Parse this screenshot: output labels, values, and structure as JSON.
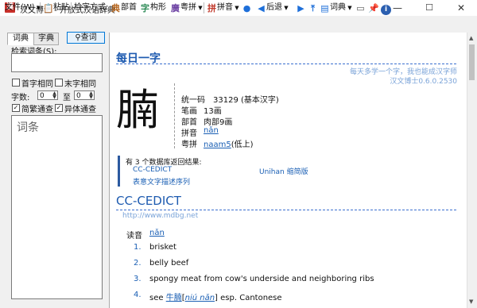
{
  "window": {
    "title": "汉文博士 - 开放式汉语辞典",
    "icon_glyph": "漢",
    "controls": {
      "minimize": "—",
      "maximize": "☐",
      "close": "✕"
    }
  },
  "toolbar": {
    "file_menu": "文件(W)",
    "paste": "粘贴",
    "search_mode_label": "检字方式:",
    "radical": "部首",
    "component": "构形",
    "cantonese": "粤拼",
    "pinyin": "拼音",
    "back": "后退",
    "dictionary": "词典"
  },
  "left_panel": {
    "tab_words": "词典",
    "tab_chars": "字典",
    "query_button": "查词",
    "search_label": "检索词条(S):",
    "search_value": "",
    "opt_first_same": "首字相同",
    "opt_last_same": "末字相同",
    "char_count_label": "字数:",
    "count_from": "0",
    "count_to_label": "至",
    "count_to": "0",
    "opt_simp_trad": "简繁通查",
    "opt_variants": "异体通查",
    "opt_simp_trad_checked": true,
    "opt_variants_checked": true,
    "list_header": "词条"
  },
  "content": {
    "daily_title": "每日一字",
    "tagline": "每天多学一个字，我也能成汉字师",
    "version": "汉文博士0.6.0.2530",
    "character": "腩",
    "info": [
      {
        "key": "统一码",
        "value": "33129 (基本汉字)"
      },
      {
        "key": "笔画",
        "value": "13画"
      },
      {
        "key": "部首",
        "value": "肉部9画"
      },
      {
        "key": "拼音",
        "value": "nǎn"
      },
      {
        "key": "粤拼",
        "value": "naam5",
        "suffix": "(低上)"
      }
    ],
    "db_header": "有 3 个数据库返回结果:",
    "db_links": [
      "CC-CEDICT",
      "Unihan 缩简版",
      "表意文字描述序列"
    ],
    "cedict_title": "CC-CEDICT",
    "cedict_url": "http://www.mdbg.net",
    "reading_label": "读音",
    "reading_value": "nǎn",
    "definitions": [
      {
        "num": "1.",
        "text": "brisket"
      },
      {
        "num": "2.",
        "text": "belly beef"
      },
      {
        "num": "3.",
        "text": "spongy meat from cow's underside and neighboring ribs"
      },
      {
        "num": "4.",
        "text_prefix": "see",
        "link1": "牛腩",
        "bracket_open": "[",
        "link2": "niú nǎn",
        "bracket_close": "]",
        "text_suffix": "esp. Cantonese"
      }
    ]
  },
  "colors": {
    "accent": "#1e5bb0",
    "link": "#1a5fb4",
    "muted_link": "#7aa3d8"
  }
}
